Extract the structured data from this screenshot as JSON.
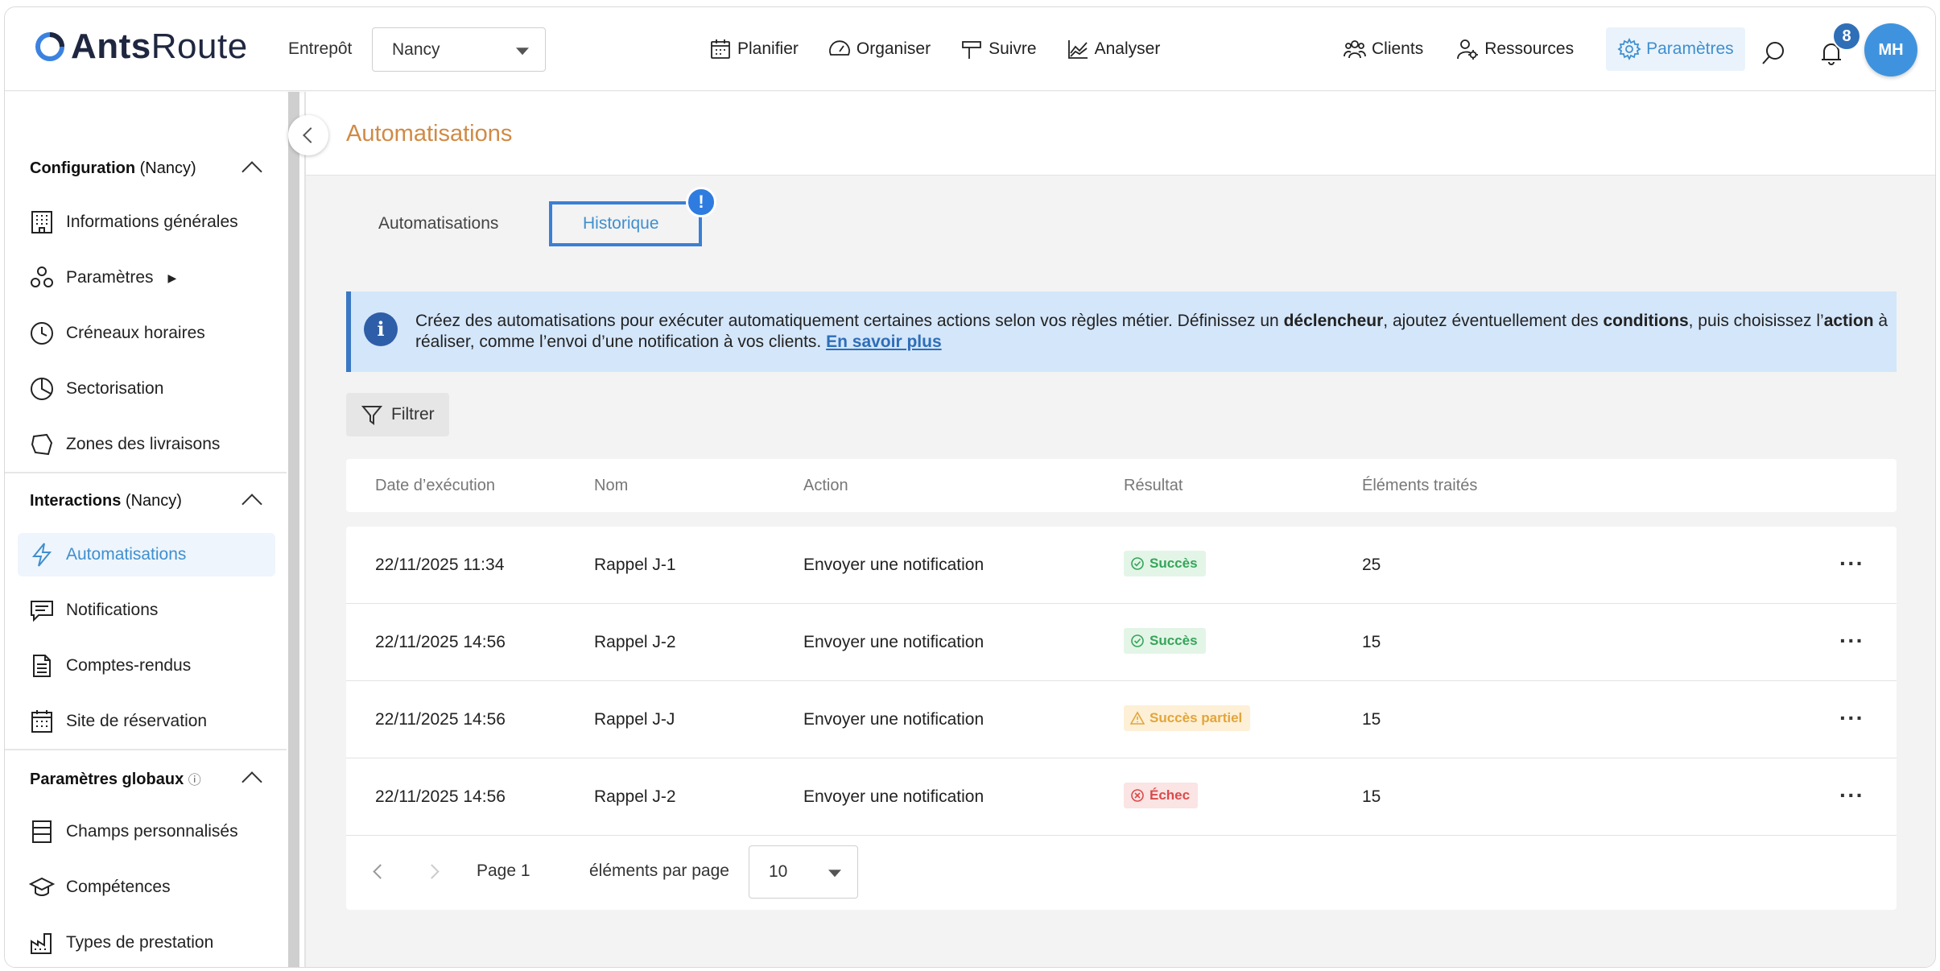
{
  "header": {
    "logo_bold": "Ants",
    "logo_light": "Route",
    "warehouse_label": "Entrepôt",
    "warehouse_value": "Nancy",
    "nav_center": [
      {
        "label": "Planifier",
        "icon": "calendar-icon"
      },
      {
        "label": "Organiser",
        "icon": "gauge-icon"
      },
      {
        "label": "Suivre",
        "icon": "signpost-icon"
      },
      {
        "label": "Analyser",
        "icon": "chart-icon"
      }
    ],
    "nav_right": [
      {
        "label": "Clients",
        "icon": "users-icon"
      },
      {
        "label": "Ressources",
        "icon": "user-gear-icon"
      },
      {
        "label": "Paramètres",
        "icon": "gear-icon",
        "active": true
      }
    ],
    "notif_count": "8",
    "avatar_initials": "MH"
  },
  "sidebar": {
    "sections": [
      {
        "title": "Configuration",
        "suffix": " (Nancy)",
        "items": [
          {
            "label": "Informations générales",
            "icon": "building-icon"
          },
          {
            "label": "Paramètres",
            "icon": "components-icon",
            "submenu_arrow": "▶"
          },
          {
            "label": "Créneaux horaires",
            "icon": "clock-icon"
          },
          {
            "label": "Sectorisation",
            "icon": "pie-icon"
          },
          {
            "label": "Zones des livraisons",
            "icon": "polygon-icon"
          }
        ]
      },
      {
        "title": "Interactions",
        "suffix": " (Nancy)",
        "items": [
          {
            "label": "Automatisations",
            "icon": "bolt-icon",
            "active": true
          },
          {
            "label": "Notifications",
            "icon": "message-icon"
          },
          {
            "label": "Comptes-rendus",
            "icon": "document-icon"
          },
          {
            "label": "Site de réservation",
            "icon": "calendar-grid-icon"
          }
        ]
      },
      {
        "title": "Paramètres globaux",
        "suffix": "",
        "info_icon": "ⓘ",
        "items": [
          {
            "label": "Champs personnalisés",
            "icon": "fields-icon"
          },
          {
            "label": "Compétences",
            "icon": "graduation-icon"
          },
          {
            "label": "Types de prestation",
            "icon": "factory-icon"
          }
        ]
      }
    ]
  },
  "main": {
    "title": "Automatisations",
    "tabs": [
      {
        "label": "Automatisations"
      },
      {
        "label": "Historique",
        "active": true,
        "alert": "!"
      }
    ],
    "info": {
      "icon": "i",
      "text_1": "Créez des automatisations pour exécuter automatiquement certaines actions selon vos règles métier. Définissez un ",
      "bold_1": "déclencheur",
      "text_2": ", ajoutez éventuellement des ",
      "bold_2": "conditions",
      "text_3": ", puis choisissez l’",
      "bold_3": "action",
      "text_4": " à réaliser, comme l’envoi d’une notification à vos clients. ",
      "link": "En savoir plus"
    },
    "filter_label": "Filtrer",
    "table": {
      "columns": [
        "Date d’exécution",
        "Nom",
        "Action",
        "Résultat",
        "Éléments traités"
      ],
      "rows": [
        {
          "date": "22/11/2025 11:34",
          "name": "Rappel J-1",
          "action": "Envoyer une notification",
          "result": "Succès",
          "status": "ok",
          "count": "25",
          "menu": "···"
        },
        {
          "date": "22/11/2025 14:56",
          "name": "Rappel J-2",
          "action": "Envoyer une notification",
          "result": "Succès",
          "status": "ok",
          "count": "15",
          "menu": "···"
        },
        {
          "date": "22/11/2025 14:56",
          "name": "Rappel J-J",
          "action": "Envoyer une notification",
          "result": "Succès partiel",
          "status": "warn",
          "count": "15",
          "menu": "···"
        },
        {
          "date": "22/11/2025 14:56",
          "name": "Rappel J-2",
          "action": "Envoyer une notification",
          "result": "Échec",
          "status": "err",
          "count": "15",
          "menu": "···"
        }
      ]
    },
    "pagination": {
      "page_label": "Page 1",
      "per_page_label": "éléments par page",
      "per_page_value": "10"
    }
  },
  "colors": {
    "accent": "#3f8fcf",
    "title": "#d08a45",
    "success": "#35a55a",
    "warning": "#e2a53c",
    "error": "#d94b4b",
    "info_bg": "#d4e6fa"
  }
}
